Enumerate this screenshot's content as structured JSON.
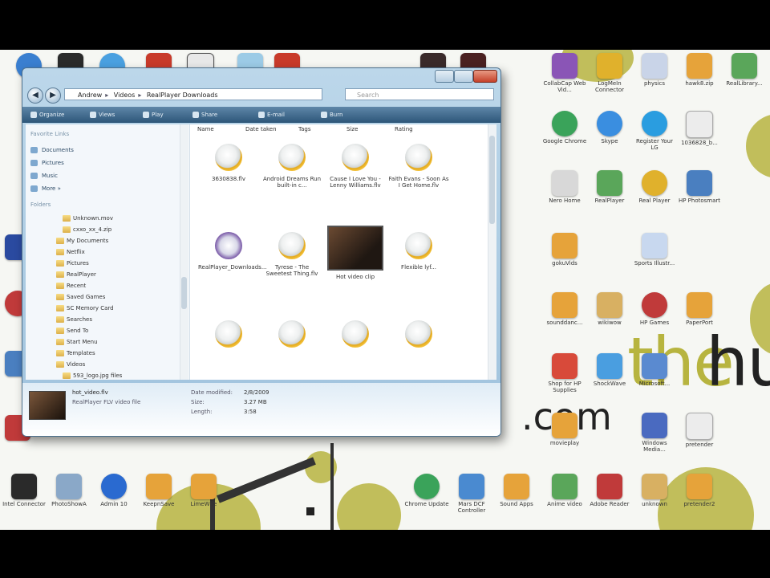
{
  "window": {
    "breadcrumb": [
      "Andrew",
      "Videos",
      "RealPlayer Downloads"
    ],
    "search_placeholder": "Search",
    "toolbar": [
      "Organize",
      "Views",
      "Play",
      "Share",
      "E-mail",
      "Burn"
    ]
  },
  "navigation": {
    "favorites_title": "Favorite Links",
    "favorites": [
      "Documents",
      "Pictures",
      "Music",
      "More »"
    ],
    "folders_title": "Folders",
    "folders": [
      "Unknown.mov",
      "cxxo_xx_4.zip",
      "My Documents",
      "Netflix",
      "Pictures",
      "RealPlayer",
      "Recent",
      "Saved Games",
      "SC Memory Card",
      "Searches",
      "Send To",
      "Start Menu",
      "Templates",
      "Videos",
      "593_logo.jpg files"
    ]
  },
  "columns": [
    "Name",
    "Date taken",
    "Tags",
    "Size",
    "Rating"
  ],
  "files": [
    {
      "name": "3630838.flv",
      "kind": "realplayer"
    },
    {
      "name": "Android Dreams Run built-in c...",
      "kind": "realplayer"
    },
    {
      "name": "Cause I Love You - Lenny Williams.flv",
      "kind": "realplayer"
    },
    {
      "name": "Faith Evans - Soon As I Get Home.flv",
      "kind": "realplayer"
    },
    {
      "name": "RealPlayer_Downloads...",
      "kind": "real"
    },
    {
      "name": "Tyrese - The Sweetest Thing.flv",
      "kind": "realplayer"
    },
    {
      "name": "Hot video clip",
      "kind": "video"
    },
    {
      "name": "Flexible lyf...",
      "kind": "realplayer"
    },
    {
      "name": "",
      "kind": "realplayer"
    },
    {
      "name": "",
      "kind": "realplayer"
    },
    {
      "name": "",
      "kind": "realplayer"
    },
    {
      "name": "",
      "kind": "realplayer"
    }
  ],
  "details": {
    "filename": "hot_video.flv",
    "type": "RealPlayer FLV video file",
    "date_label": "Date modified:",
    "date_value": "2/8/2009",
    "size_label": "Size:",
    "size_value": "3.27 MB",
    "length_label": "Length:",
    "length_value": "3:58"
  },
  "desktop": {
    "wallpaper_word1": "the",
    "wallpaper_word2": "hu",
    "wallpaper_com": ".com",
    "icons": [
      {
        "label": "CollabCap Web Vid...",
        "color": "#8a55b6"
      },
      {
        "label": "LogMeIn Connector",
        "color": "#e0b12c"
      },
      {
        "label": "physics",
        "color": "#c9d4e8"
      },
      {
        "label": "hawk8.zip",
        "color": "#e6a33a"
      },
      {
        "label": "RealLibrary...",
        "color": "#5aa65a"
      },
      {
        "label": "Google Chrome",
        "color": "#3aa35a"
      },
      {
        "label": "Skype",
        "color": "#3a8ee0"
      },
      {
        "label": "Register Your LG",
        "color": "#2a9de0"
      },
      {
        "label": "1036828_b...",
        "color": "#ececec"
      },
      {
        "label": "Nero Home",
        "color": "#d8d8d8"
      },
      {
        "label": "RealPlayer",
        "color": "#d8d8d8"
      },
      {
        "label": "Real Player",
        "color": "#e0b12c"
      },
      {
        "label": "HP Photosmart",
        "color": "#4a7fc0"
      },
      {
        "label": "gokuVids",
        "color": "#e6a33a"
      },
      {
        "label": "Sports Illustr...",
        "color": "#c8d8ef"
      },
      {
        "label": "sounddanc...",
        "color": "#e6a33a"
      },
      {
        "label": "wikiwow",
        "color": "#d8b062"
      },
      {
        "label": "HP Games",
        "color": "#c03a3a"
      },
      {
        "label": "PaperPort",
        "color": "#e6a33a"
      },
      {
        "label": "Shop for HP Supplies",
        "color": "#d84a3a"
      },
      {
        "label": "ShockWave",
        "color": "#4a9ee0"
      },
      {
        "label": "Microsoft...",
        "color": "#5a8ad0"
      },
      {
        "label": "movieplay",
        "color": "#e6a33a"
      },
      {
        "label": "Windows Media...",
        "color": "#4a6ac0"
      },
      {
        "label": "pretender",
        "color": "#ececec"
      },
      {
        "label": "Intel Connector",
        "color": "#2a2a2a"
      },
      {
        "label": "PhotoShowA",
        "color": "#8aa8c8"
      },
      {
        "label": "Admin 10",
        "color": "#2a6ad0"
      },
      {
        "label": "KeepnSave",
        "color": "#e6a33a"
      },
      {
        "label": "LimeWire",
        "color": "#e6a33a"
      },
      {
        "label": "Chrome Update",
        "color": "#3aa35a"
      },
      {
        "label": "Mars DCF Controller",
        "color": "#4a8ad0"
      },
      {
        "label": "Sound Apps",
        "color": "#e6a33a"
      },
      {
        "label": "Anime video",
        "color": "#5aa65a"
      },
      {
        "label": "Adobe Reader",
        "color": "#c03a3a"
      },
      {
        "label": "unknown",
        "color": "#d8b062"
      },
      {
        "label": "pretender2",
        "color": "#e6a33a"
      }
    ]
  },
  "colors": {
    "window_frame": "#9fc2dd",
    "toolbar": "#2d5679",
    "accent_olive": "#b7b43f"
  }
}
